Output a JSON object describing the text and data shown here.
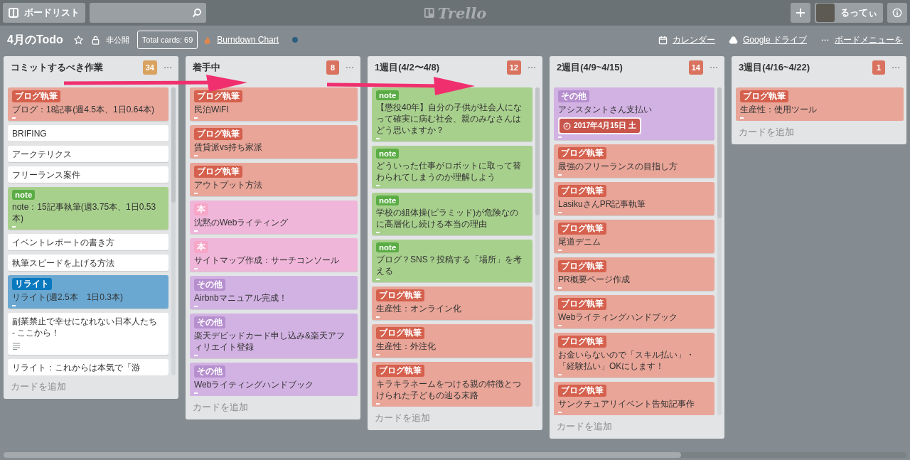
{
  "topbar": {
    "boards_button": "ボードリスト",
    "logo": "Trello",
    "user_name": "るってぃ"
  },
  "board": {
    "title": "4月のTodo",
    "visibility": "非公開",
    "total_cards": "Total cards: 69",
    "burndown": "Burndown Chart",
    "calendar": "カレンダー",
    "drive": "Google ドライブ",
    "menu": "ボードメニューを"
  },
  "lists": [
    {
      "title": "コミットするべき作業",
      "count": "34",
      "color": "#d9a25f",
      "add_card": "カードを追加",
      "scrollable": true,
      "cards": [
        {
          "kind": "label",
          "label": {
            "text": "ブログ執筆",
            "color": "#d5604d"
          },
          "color": "#e8a598",
          "text": "ブログ：18記事(週4.5本、1日0.64本)"
        },
        {
          "kind": "plain",
          "color": "#ffffff",
          "text": "BRIFING"
        },
        {
          "kind": "plain",
          "color": "#ffffff",
          "text": "アークテリクス"
        },
        {
          "kind": "plain",
          "color": "#ffffff",
          "text": "フリーランス案件"
        },
        {
          "kind": "label",
          "label": {
            "text": "note",
            "color": "#5aac44"
          },
          "color": "#a8d08d",
          "text": "note：15記事執筆(週3.75本、1日0.53本)"
        },
        {
          "kind": "plain",
          "color": "#ffffff",
          "text": "イベントレポートの書き方"
        },
        {
          "kind": "plain",
          "color": "#ffffff",
          "text": "執筆スピードを上げる方法"
        },
        {
          "kind": "label",
          "label": {
            "text": "リライト",
            "color": "#0a79bf"
          },
          "color": "#6aa8d2",
          "text": "リライト(週2.5本　1日0.3本)"
        },
        {
          "kind": "description",
          "color": "#ffffff",
          "text": "副業禁止で幸せになれない日本人たち - ここから！"
        },
        {
          "kind": "plain",
          "color": "#ffffff",
          "text": "リライト：これからは本気で「游"
        }
      ]
    },
    {
      "title": "着手中",
      "count": "8",
      "color": "#d9735f",
      "add_card": "カードを追加",
      "scrollable": false,
      "cards": [
        {
          "kind": "label",
          "label": {
            "text": "ブログ執筆",
            "color": "#d5604d"
          },
          "color": "#e8a598",
          "text": "民泊WiFI"
        },
        {
          "kind": "label",
          "label": {
            "text": "ブログ執筆",
            "color": "#d5604d"
          },
          "color": "#e8a598",
          "text": "賃貸派vs持ち家派"
        },
        {
          "kind": "label",
          "label": {
            "text": "ブログ執筆",
            "color": "#d5604d"
          },
          "color": "#e8a598",
          "text": "アウトプット方法"
        },
        {
          "kind": "label",
          "label": {
            "text": "本",
            "color": "#f7a6c8"
          },
          "color": "#f0b6d9",
          "text": "沈黙のWebライティング"
        },
        {
          "kind": "label",
          "label": {
            "text": "本",
            "color": "#f7a6c8"
          },
          "color": "#f0b6d9",
          "text": "サイトマップ作成：サーチコンソール"
        },
        {
          "kind": "label",
          "label": {
            "text": "その他",
            "color": "#b68fce"
          },
          "color": "#d2b2e3",
          "text": "Airbnbマニュアル完成！"
        },
        {
          "kind": "label",
          "label": {
            "text": "その他",
            "color": "#b68fce"
          },
          "color": "#d2b2e3",
          "text": "楽天デビッドカード申し込み&楽天アフィリエイト登録"
        },
        {
          "kind": "label",
          "label": {
            "text": "その他",
            "color": "#b68fce"
          },
          "color": "#d2b2e3",
          "text": "Webライティングハンドブック"
        }
      ]
    },
    {
      "title": "1週目(4/2〜4/8)",
      "count": "12",
      "color": "#d9735f",
      "add_card": "カードを追加",
      "scrollable": true,
      "cards": [
        {
          "kind": "label",
          "label": {
            "text": "note",
            "color": "#5aac44"
          },
          "color": "#a8d08d",
          "text": "【懲役40年】自分の子供が社会人になって確実に病む社会、親のみなさんはどう思いますか？"
        },
        {
          "kind": "label",
          "label": {
            "text": "note",
            "color": "#5aac44"
          },
          "color": "#a8d08d",
          "text": "どういった仕事がロボットに取って替わられてしまうのか理解しよう"
        },
        {
          "kind": "label",
          "label": {
            "text": "note",
            "color": "#5aac44"
          },
          "color": "#a8d08d",
          "text": "学校の組体操(ピラミッド)が危険なのに高層化し続ける本当の理由"
        },
        {
          "kind": "label",
          "label": {
            "text": "note",
            "color": "#5aac44"
          },
          "color": "#a8d08d",
          "text": "ブログ？SNS？投稿する「場所」を考える"
        },
        {
          "kind": "label",
          "label": {
            "text": "ブログ執筆",
            "color": "#d5604d"
          },
          "color": "#e8a598",
          "text": "生産性：オンライン化"
        },
        {
          "kind": "label",
          "label": {
            "text": "ブログ執筆",
            "color": "#d5604d"
          },
          "color": "#e8a598",
          "text": "生産性：外注化"
        },
        {
          "kind": "label",
          "label": {
            "text": "ブログ執筆",
            "color": "#d5604d"
          },
          "color": "#e8a598",
          "text": "キラキラネームをつける親の特徴とつけられた子どもの辿る末路"
        }
      ]
    },
    {
      "title": "2週目(4/9~4/15)",
      "count": "14",
      "color": "#d9735f",
      "add_card": "カードを追加",
      "scrollable": true,
      "cards": [
        {
          "kind": "label",
          "label": {
            "text": "その他",
            "color": "#b68fce"
          },
          "color": "#d2b2e3",
          "text": "アシスタントさん支払い",
          "due": "2017年4月15日 土"
        },
        {
          "kind": "label",
          "label": {
            "text": "ブログ執筆",
            "color": "#d5604d"
          },
          "color": "#e8a598",
          "text": "最強のフリーランスの目指し方"
        },
        {
          "kind": "label",
          "label": {
            "text": "ブログ執筆",
            "color": "#d5604d"
          },
          "color": "#e8a598",
          "text": "LasikuさんPR記事執筆"
        },
        {
          "kind": "label",
          "label": {
            "text": "ブログ執筆",
            "color": "#d5604d"
          },
          "color": "#e8a598",
          "text": "尾道デニム"
        },
        {
          "kind": "label",
          "label": {
            "text": "ブログ執筆",
            "color": "#d5604d"
          },
          "color": "#e8a598",
          "text": "PR概要ページ作成"
        },
        {
          "kind": "label",
          "label": {
            "text": "ブログ執筆",
            "color": "#d5604d"
          },
          "color": "#e8a598",
          "text": "Webライティングハンドブック"
        },
        {
          "kind": "label",
          "label": {
            "text": "ブログ執筆",
            "color": "#d5604d"
          },
          "color": "#e8a598",
          "text": "お金いらないので「スキル払い」・「経験払い」OKにします！"
        },
        {
          "kind": "label",
          "label": {
            "text": "ブログ執筆",
            "color": "#d5604d"
          },
          "color": "#e8a598",
          "text": "サンクチュアリイベント告知記事作"
        }
      ]
    },
    {
      "title": "3週目(4/16~4/22)",
      "count": "1",
      "color": "#d9735f",
      "add_card": "カードを追加",
      "scrollable": false,
      "cards": [
        {
          "kind": "label",
          "label": {
            "text": "ブログ執筆",
            "color": "#d5604d"
          },
          "color": "#e8a598",
          "text": "生産性：使用ツール"
        }
      ]
    }
  ]
}
